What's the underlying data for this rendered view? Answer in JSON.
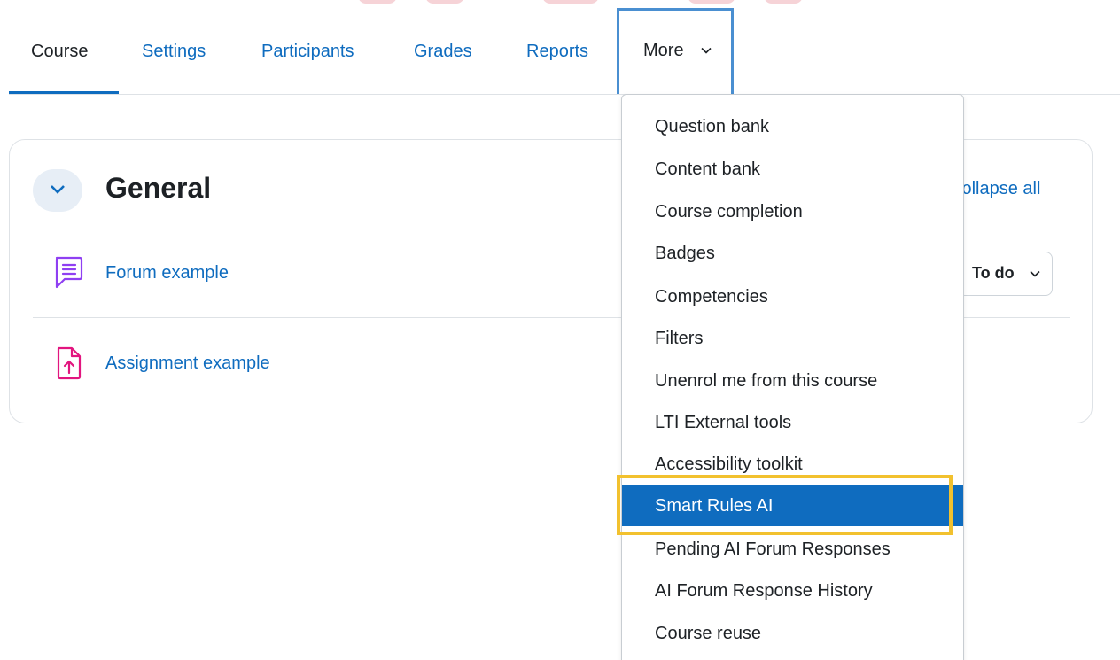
{
  "nav": {
    "tabs": [
      {
        "label": "Course",
        "active": true
      },
      {
        "label": "Settings"
      },
      {
        "label": "Participants"
      },
      {
        "label": "Grades"
      },
      {
        "label": "Reports"
      }
    ],
    "more_label": "More"
  },
  "section": {
    "title": "General",
    "collapse_all": "Collapse all",
    "activities": [
      {
        "name": "Forum example",
        "type_icon": "forum-icon"
      },
      {
        "name": "Assignment example",
        "type_icon": "assignment-icon"
      }
    ],
    "completion_button": "To do"
  },
  "more_menu": {
    "items": [
      "Question bank",
      "Content bank",
      "Course completion",
      "Badges",
      "Competencies",
      "Filters",
      "Unenrol me from this course",
      "LTI External tools",
      "Accessibility toolkit",
      "Smart Rules AI",
      "Pending AI Forum Responses",
      "AI Forum Response History",
      "Course reuse"
    ],
    "selected": "Smart Rules AI"
  },
  "colors": {
    "link": "#0f6cbf",
    "text": "#1d2125",
    "forum_icon": "#8f3ff2",
    "assignment_icon": "#e2157f",
    "highlight_box": "#f2c12e",
    "tab_box": "#4a8fd1"
  }
}
